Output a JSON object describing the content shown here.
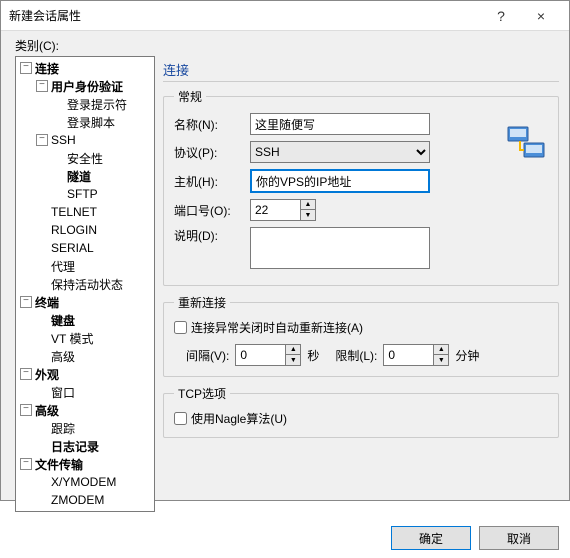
{
  "window": {
    "title": "新建会话属性",
    "help": "?",
    "close": "×"
  },
  "category_label": "类别(C):",
  "tree": {
    "connection": "连接",
    "auth": "用户身份验证",
    "login_prompt": "登录提示符",
    "login_script": "登录脚本",
    "ssh": "SSH",
    "security": "安全性",
    "tunnel": "隧道",
    "sftp": "SFTP",
    "telnet": "TELNET",
    "rlogin": "RLOGIN",
    "serial": "SERIAL",
    "proxy": "代理",
    "keepalive": "保持活动状态",
    "terminal": "终端",
    "keyboard": "键盘",
    "vtmode": "VT 模式",
    "advanced": "高级",
    "appearance": "外观",
    "window": "窗口",
    "advanced2": "高级",
    "trace": "跟踪",
    "logging": "日志记录",
    "filetransfer": "文件传输",
    "xymodem": "X/YMODEM",
    "zmodem": "ZMODEM"
  },
  "panel_title": "连接",
  "general": {
    "legend": "常规",
    "name_label": "名称(N):",
    "name_value": "这里随便写",
    "protocol_label": "协议(P):",
    "protocol_value": "SSH",
    "host_label": "主机(H):",
    "host_value": "你的VPS的IP地址",
    "port_label": "端口号(O):",
    "port_value": "22",
    "desc_label": "说明(D):",
    "desc_value": ""
  },
  "reconnect": {
    "legend": "重新连接",
    "checkbox": "连接异常关闭时自动重新连接(A)",
    "interval_label": "间隔(V):",
    "interval_value": "0",
    "seconds": "秒",
    "limit_label": "限制(L):",
    "limit_value": "0",
    "minutes": "分钟"
  },
  "tcp": {
    "legend": "TCP选项",
    "nagle": "使用Nagle算法(U)"
  },
  "buttons": {
    "ok": "确定",
    "cancel": "取消"
  }
}
